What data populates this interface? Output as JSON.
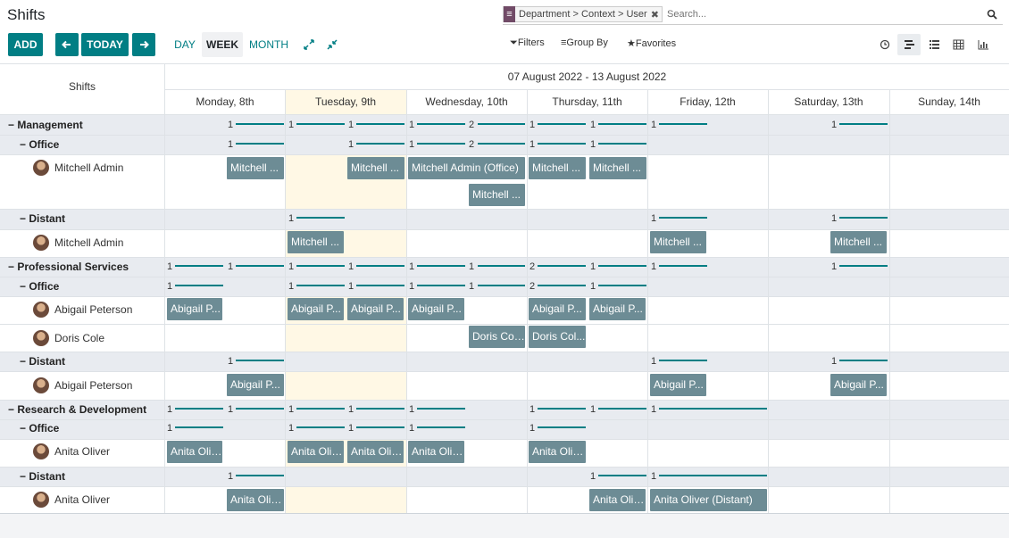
{
  "app": {
    "title": "Shifts"
  },
  "toolbar": {
    "add": "ADD",
    "today": "TODAY",
    "day": "DAY",
    "week": "WEEK",
    "month": "MONTH"
  },
  "search": {
    "facet": "Department > Context > User",
    "placeholder": "Search..."
  },
  "filters": {
    "filters": "Filters",
    "groupby": "Group By",
    "favorites": "Favorites"
  },
  "gantt": {
    "header_label": "Shifts",
    "range": "07 August 2022 - 13 August 2022",
    "days": [
      "Monday, 8th",
      "Tuesday, 9th",
      "Wednesday, 10th",
      "Thursday, 11th",
      "Friday, 12th",
      "Saturday, 13th",
      "Sunday, 14th"
    ]
  },
  "rows": {
    "management": "Management",
    "mgmt_office": "Office",
    "mgmt_office_user": "Mitchell Admin",
    "mgmt_distant": "Distant",
    "mgmt_distant_user": "Mitchell Admin",
    "ps": "Professional Services",
    "ps_office": "Office",
    "ps_office_user1": "Abigail Peterson",
    "ps_office_user2": "Doris Cole",
    "ps_distant": "Distant",
    "ps_distant_user": "Abigail Peterson",
    "rd": "Research & Development",
    "rd_office": "Office",
    "rd_office_user": "Anita Oliver",
    "rd_distant": "Distant",
    "rd_distant_user": "Anita Oliver"
  },
  "pills": {
    "ma1": "Mitchell ...",
    "ma2": "Mitchell ...",
    "ma3": "Mitchell Admin (Office)",
    "ma4": "Mitchell ...",
    "ma5": "Mitchell ...",
    "ma6": "Mitchell ...",
    "md1": "Mitchell ...",
    "md2": "Mitchell ...",
    "md3": "Mitchell ...",
    "ap1": "Abigail P...",
    "ap2": "Abigail P...",
    "ap3": "Abigail P...",
    "ap4": "Abigail P...",
    "ap5": "Abigail P...",
    "ap6": "Abigail P...",
    "dc1": "Doris Col...",
    "dc2": "Doris Col...",
    "apd1": "Abigail P...",
    "apd2": "Abigail P...",
    "apd3": "Abigail P...",
    "ao1": "Anita Oliv...",
    "ao2": "Anita Oliv...",
    "ao3": "Anita Oliv...",
    "ao4": "Anita Oliv...",
    "ao5": "Anita Oliv...",
    "aod1": "Anita Oliv...",
    "aod2": "Anita Oliv...",
    "aod3": "Anita Oliver (Distant)"
  },
  "counts": {
    "one": "1",
    "two": "2"
  }
}
